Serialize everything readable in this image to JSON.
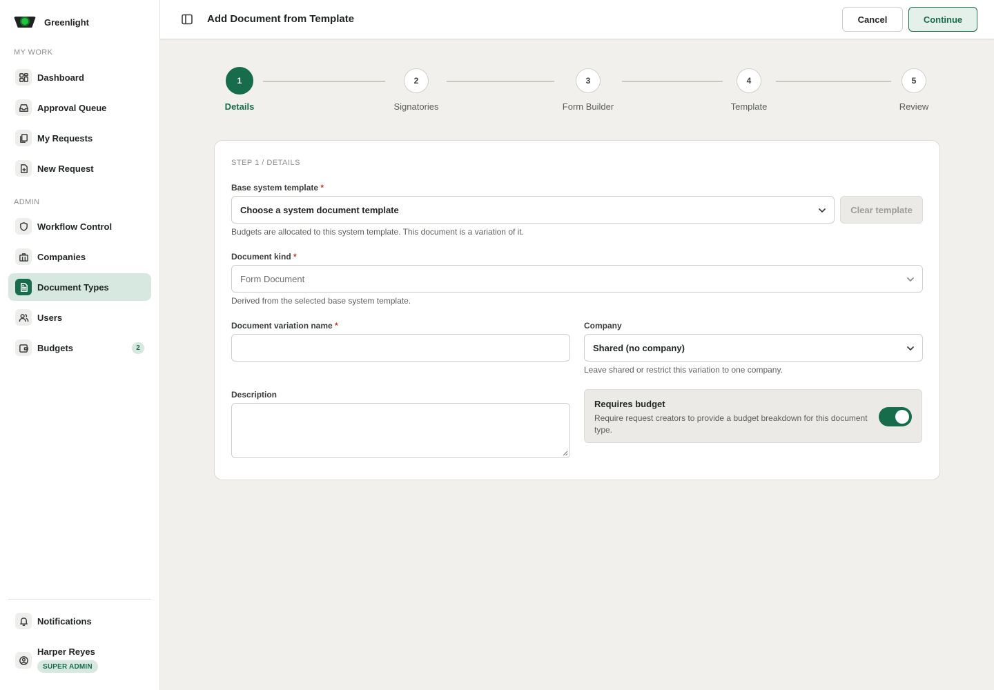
{
  "brand": {
    "name": "Greenlight"
  },
  "sidebar": {
    "sections": [
      {
        "label": "MY WORK"
      },
      {
        "label": "ADMIN"
      }
    ],
    "items": [
      {
        "label": "Dashboard",
        "icon": "dashboard-icon"
      },
      {
        "label": "Approval Queue",
        "icon": "inbox-icon"
      },
      {
        "label": "My Requests",
        "icon": "documents-icon"
      },
      {
        "label": "New Request",
        "icon": "file-plus-icon"
      },
      {
        "label": "Workflow Control",
        "icon": "shield-icon"
      },
      {
        "label": "Companies",
        "icon": "building-icon"
      },
      {
        "label": "Document Types",
        "icon": "document-icon",
        "active": true
      },
      {
        "label": "Users",
        "icon": "users-icon"
      },
      {
        "label": "Budgets",
        "icon": "wallet-icon",
        "badge": "2"
      }
    ],
    "footer": {
      "notifications": "Notifications",
      "user_name": "Harper Reyes",
      "user_role": "SUPER ADMIN"
    }
  },
  "header": {
    "title": "Add Document from Template",
    "cancel_label": "Cancel",
    "continue_label": "Continue"
  },
  "stepper": {
    "current": 1,
    "steps": [
      {
        "number": "1",
        "label": "Details"
      },
      {
        "number": "2",
        "label": "Signatories"
      },
      {
        "number": "3",
        "label": "Form Builder"
      },
      {
        "number": "4",
        "label": "Template"
      },
      {
        "number": "5",
        "label": "Review"
      }
    ]
  },
  "form": {
    "eyebrow": "STEP 1 / DETAILS",
    "base_template": {
      "label": "Base system template",
      "required_mark": "*",
      "value": "Choose a system document template",
      "helper": "Budgets are allocated to this system template. This document is a variation of it.",
      "clear_label": "Clear template"
    },
    "document_kind": {
      "label": "Document kind",
      "required_mark": "*",
      "value": "Form Document",
      "helper": "Derived from the selected base system template."
    },
    "variation_name": {
      "label": "Document variation name",
      "required_mark": "*",
      "value": ""
    },
    "company": {
      "label": "Company",
      "value": "Shared (no company)",
      "helper": "Leave shared or restrict this variation to one company."
    },
    "description": {
      "label": "Description",
      "value": ""
    },
    "requires_budget": {
      "title": "Requires budget",
      "description": "Require request creators to provide a budget breakdown for this document type.",
      "enabled": true
    }
  },
  "colors": {
    "accent": "#176c4b",
    "accent_soft": "#d7e8e0",
    "page_bg": "#f1f0ec",
    "required": "#c0392b"
  }
}
